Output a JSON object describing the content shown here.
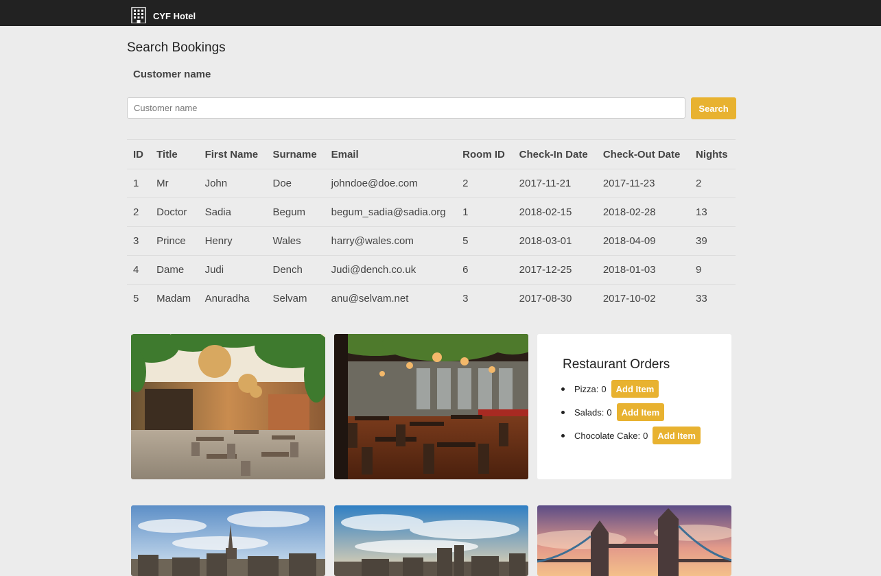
{
  "navbar": {
    "brand": "CYF Hotel",
    "icon": "hotel-building-icon"
  },
  "search": {
    "title": "Search Bookings",
    "label": "Customer name",
    "placeholder": "Customer name",
    "button_label": "Search"
  },
  "table": {
    "headers": [
      "ID",
      "Title",
      "First Name",
      "Surname",
      "Email",
      "Room ID",
      "Check-In Date",
      "Check-Out Date",
      "Nights"
    ],
    "rows": [
      [
        "1",
        "Mr",
        "John",
        "Doe",
        "johndoe@doe.com",
        "2",
        "2017-11-21",
        "2017-11-23",
        "2"
      ],
      [
        "2",
        "Doctor",
        "Sadia",
        "Begum",
        "begum_sadia@sadia.org",
        "1",
        "2018-02-15",
        "2018-02-28",
        "13"
      ],
      [
        "3",
        "Prince",
        "Henry",
        "Wales",
        "harry@wales.com",
        "5",
        "2018-03-01",
        "2018-04-09",
        "39"
      ],
      [
        "4",
        "Dame",
        "Judi",
        "Dench",
        "Judi@dench.co.uk",
        "6",
        "2017-12-25",
        "2018-01-03",
        "9"
      ],
      [
        "5",
        "Madam",
        "Anuradha",
        "Selvam",
        "anu@selvam.net",
        "3",
        "2017-08-30",
        "2017-10-02",
        "33"
      ]
    ]
  },
  "orders": {
    "title": "Restaurant Orders",
    "items": [
      {
        "name": "Pizza:",
        "count": "0",
        "button": "Add Item"
      },
      {
        "name": "Salads:",
        "count": "0",
        "button": "Add Item"
      },
      {
        "name": "Chocolate Cake:",
        "count": "0",
        "button": "Add Item"
      }
    ]
  },
  "colors": {
    "navbar": "#222222",
    "accent": "#e8b230",
    "background": "#ececec"
  }
}
